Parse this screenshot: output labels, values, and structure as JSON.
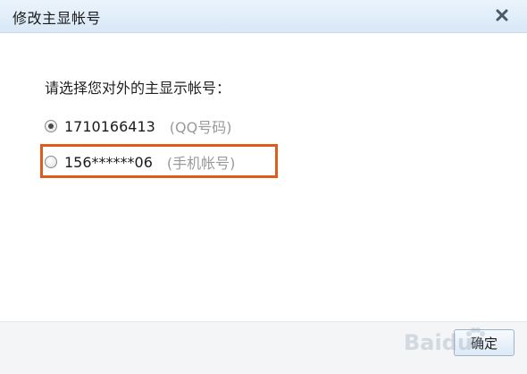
{
  "dialog": {
    "title": "修改主显帐号",
    "close_icon": "close-icon"
  },
  "prompt": "请选择您对外的主显示帐号：",
  "options": [
    {
      "account": "1710166413",
      "note": "(QQ号码)",
      "selected": true
    },
    {
      "account": "156******06",
      "note": "(手机帐号)",
      "selected": false
    }
  ],
  "footer": {
    "ok_label": "确定"
  },
  "watermark": {
    "text": "Baidu"
  },
  "colors": {
    "highlight": "#e05a1b",
    "titlebar": "#d9e8f6",
    "note_text": "#9a9a9a"
  }
}
